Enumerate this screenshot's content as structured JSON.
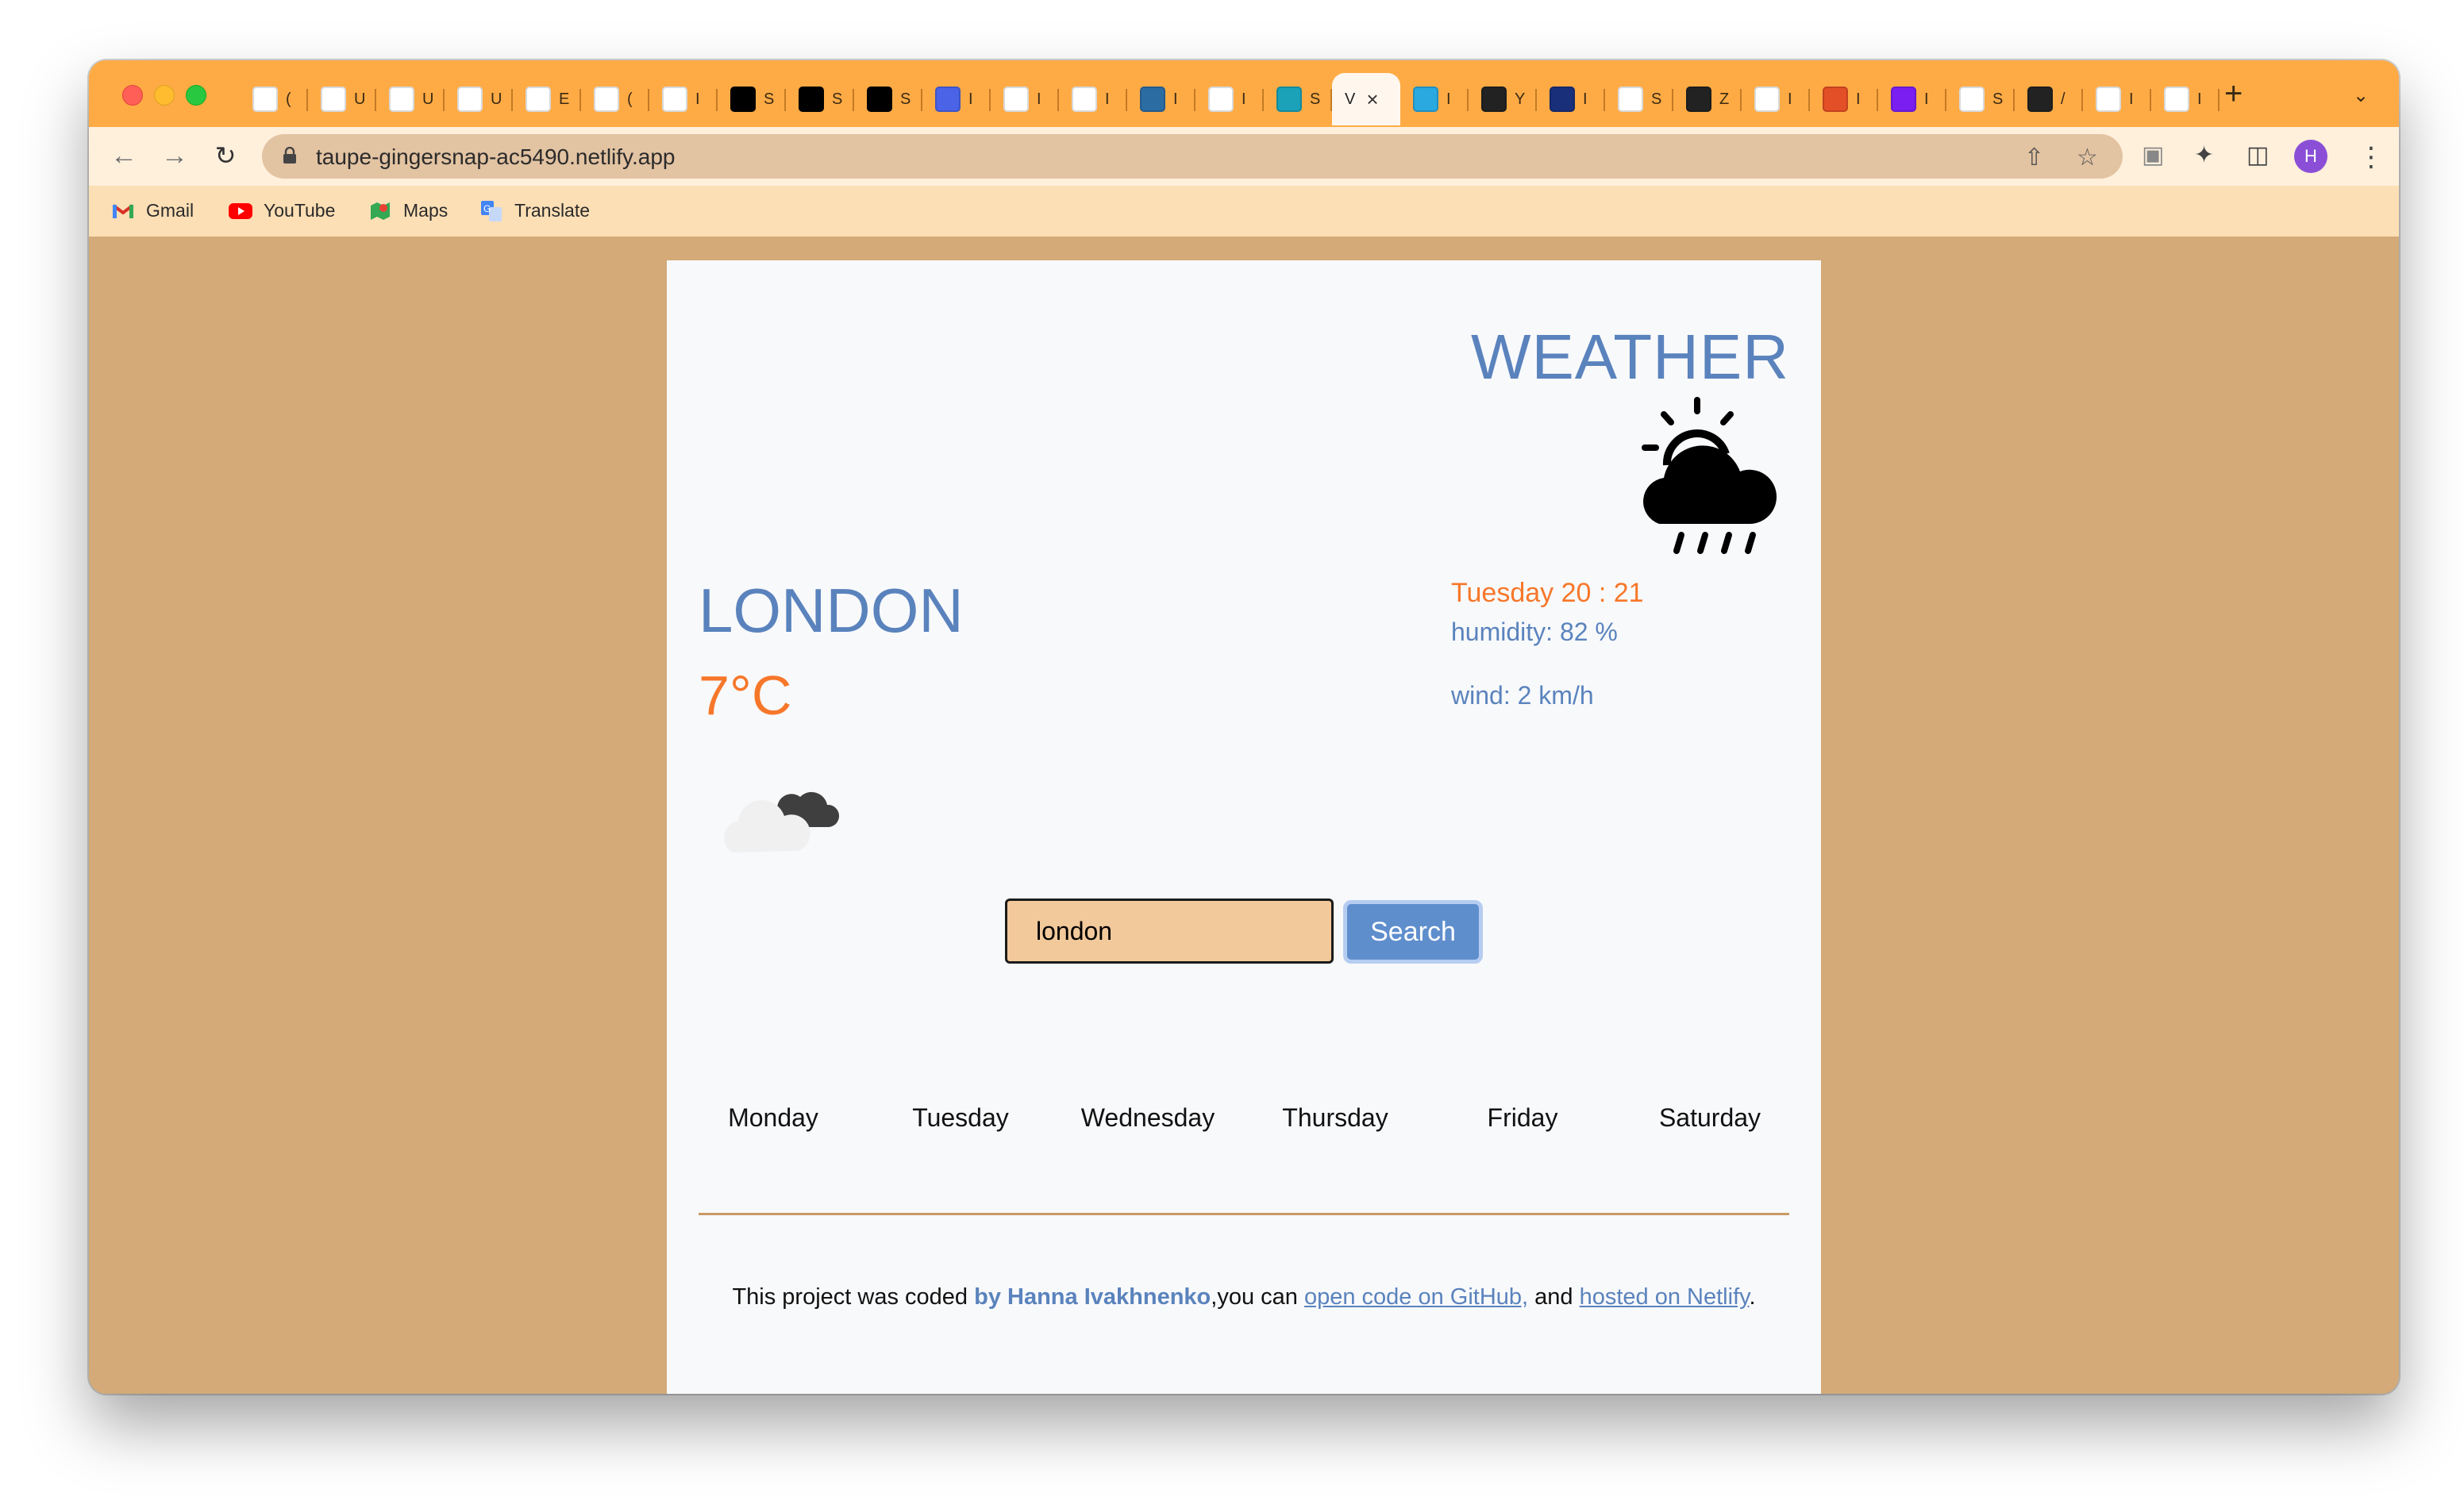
{
  "browser": {
    "tabs": [
      {
        "icon": "gmail-icon",
        "label": "(",
        "color": "#ffffff"
      },
      {
        "icon": "figma-icon",
        "label": "U",
        "color": "#ffffff"
      },
      {
        "icon": "figma-icon",
        "label": "U",
        "color": "#ffffff"
      },
      {
        "icon": "figma-icon",
        "label": "U",
        "color": "#ffffff"
      },
      {
        "icon": "landscape-icon",
        "label": "E",
        "color": "#ffffff"
      },
      {
        "icon": "bug-icon",
        "label": "(",
        "color": "#ffffff"
      },
      {
        "icon": "building-icon",
        "label": "I",
        "color": "#ffffff"
      },
      {
        "icon": "square-icon",
        "label": "S",
        "color": "#000000"
      },
      {
        "icon": "square-icon",
        "label": "S",
        "color": "#000000"
      },
      {
        "icon": "square-icon",
        "label": "S",
        "color": "#000000"
      },
      {
        "icon": "signature-icon",
        "label": "I",
        "color": "#4a63e7"
      },
      {
        "icon": "blank-doc-icon",
        "label": "I",
        "color": "#ffffff"
      },
      {
        "icon": "blank-doc-icon",
        "label": "I",
        "color": "#ffffff"
      },
      {
        "icon": "cube-icon",
        "label": "I",
        "color": "#2b6ca3"
      },
      {
        "icon": "github-icon",
        "label": "I",
        "color": "#ffffff"
      },
      {
        "icon": "diamond-icon",
        "label": "S",
        "color": "#1ba1b8"
      },
      {
        "icon": "active-tab",
        "label": "V",
        "color": "#ffffff",
        "active": true
      },
      {
        "icon": "circle-c-icon",
        "label": "I",
        "color": "#2aa9e0"
      },
      {
        "icon": "raccoon-icon",
        "label": "Y",
        "color": "#222222"
      },
      {
        "icon": "m-logo-icon",
        "label": "I",
        "color": "#1a2f7a"
      },
      {
        "icon": "thermometer-icon",
        "label": "S",
        "color": "#ffffff"
      },
      {
        "icon": "g-square-icon",
        "label": "Z",
        "color": "#222222"
      },
      {
        "icon": "google-icon",
        "label": "I",
        "color": "#ffffff"
      },
      {
        "icon": "html5-icon",
        "label": "I",
        "color": "#e34f26"
      },
      {
        "icon": "bootstrap-icon",
        "label": "I",
        "color": "#7a1ef2"
      },
      {
        "icon": "dots-icon",
        "label": "S",
        "color": "#ffffff"
      },
      {
        "icon": "globe-icon",
        "label": "/",
        "color": "#222222"
      },
      {
        "icon": "google-icon",
        "label": "I",
        "color": "#ffffff"
      },
      {
        "icon": "google-icon",
        "label": "I",
        "color": "#ffffff"
      }
    ],
    "url": "taupe-gingersnap-ac5490.netlify.app",
    "profile_initial": "H",
    "bookmarks": [
      {
        "label": "Gmail",
        "icon": "gmail-icon"
      },
      {
        "label": "YouTube",
        "icon": "youtube-icon"
      },
      {
        "label": "Maps",
        "icon": "maps-icon"
      },
      {
        "label": "Translate",
        "icon": "translate-icon"
      }
    ]
  },
  "app": {
    "title": "WEATHER",
    "city": "LONDON",
    "temperature": "7°C",
    "date": "Tuesday 20 : 21",
    "humidity": "humidity: 82 %",
    "wind": "wind: 2 km/h",
    "search": {
      "value": "london",
      "button": "Search"
    },
    "forecast_days": [
      "Monday",
      "Tuesday",
      "Wednesday",
      "Thursday",
      "Friday",
      "Saturday"
    ],
    "footer": {
      "prefix": "This project was coded ",
      "author": "by Hanna Ivakhnenko",
      "middle": ",you can ",
      "github_link": "open code on GitHub,",
      "and": " and ",
      "netlify_link": "hosted on Netlify",
      "suffix": "."
    },
    "colors": {
      "accent": "#5a83bd",
      "orange": "#f7772a",
      "background": "#d3aa78"
    }
  }
}
